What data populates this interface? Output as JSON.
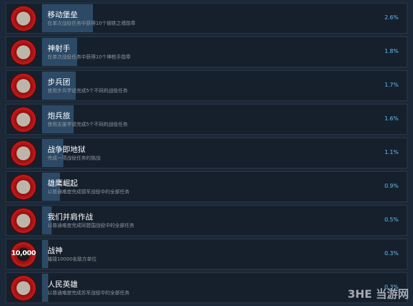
{
  "achievements": [
    {
      "title": "移动堡垒",
      "desc": "在单次战役任务中获得10个钢铁之墙勋章",
      "percent": "2.6%",
      "progress": 0.026,
      "icon": "tank-icon"
    },
    {
      "title": "神射手",
      "desc": "在单次战役任务中获得10个神枪手勋章",
      "percent": "1.8%",
      "progress": 0.018,
      "icon": "crossed-rifles-icon"
    },
    {
      "title": "步兵团",
      "desc": "使用步兵学说完成5个不同的战役任务",
      "percent": "1.7%",
      "progress": 0.017,
      "icon": "infantry-soldier-icon"
    },
    {
      "title": "炮兵旅",
      "desc": "使用支援学说完成5个不同的战役任务",
      "percent": "1.6%",
      "progress": 0.016,
      "icon": "artillery-gun-icon"
    },
    {
      "title": "战争即地狱",
      "desc": "完成一项战役任务的挑战",
      "percent": "1.1%",
      "progress": 0.011,
      "icon": "explosion-cloud-icon"
    },
    {
      "title": "雄鹰崛起",
      "desc": "以普通难度完成德军战役中的全部任务",
      "percent": "0.9%",
      "progress": 0.009,
      "icon": "eagle-emblem-icon"
    },
    {
      "title": "我们并肩作战",
      "desc": "以普通难度完成同盟国战役中的全部任务",
      "percent": "0.5%",
      "progress": 0.005,
      "icon": "crossed-swords-icon"
    },
    {
      "title": "战神",
      "desc": "摧毁10000名敌方单位",
      "percent": "0.3%",
      "progress": 0.003,
      "icon": "10000-badge-icon",
      "badge_text": "10,000"
    },
    {
      "title": "人民英雄",
      "desc": "以普通难度完成苏军战役中的全部任务",
      "percent": "0.3%",
      "progress": 0.003,
      "icon": "soviet-soldier-icon"
    }
  ],
  "watermark": "3HE 当游网",
  "colors": {
    "background": "#1b2838",
    "row": "#16202d",
    "percent": "#66c0f4",
    "progress": "#2c4a66",
    "badge_red": "#c01a1a"
  }
}
